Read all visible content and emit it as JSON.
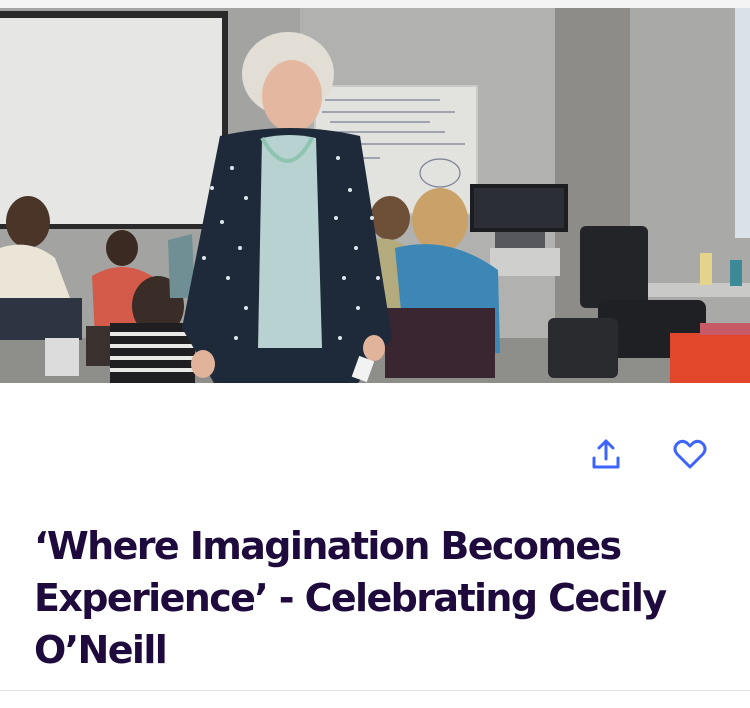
{
  "event": {
    "image_alt": "Cecily O'Neill standing in a classroom workshop",
    "title": "‘Where Imagination Becomes Experience’ - Celebrating Cecily O’Neill"
  },
  "actions": {
    "share_icon": "share-icon",
    "favorite_icon": "heart-icon"
  },
  "colors": {
    "accent": "#3d64ff",
    "title": "#1e0a3c"
  }
}
